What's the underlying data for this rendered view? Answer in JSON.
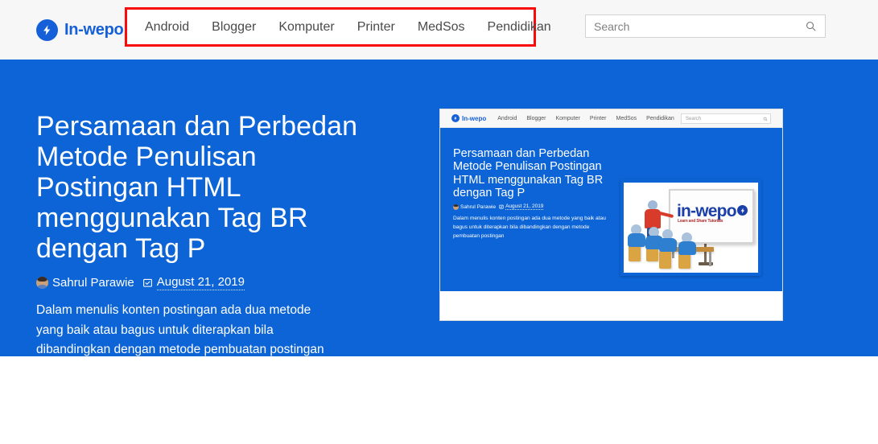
{
  "header": {
    "brand": {
      "name": "In-wepo",
      "icon": "bolt-icon",
      "color": "#1560d8"
    },
    "nav": [
      {
        "label": "Android"
      },
      {
        "label": "Blogger"
      },
      {
        "label": "Komputer"
      },
      {
        "label": "Printer"
      },
      {
        "label": "MedSos"
      },
      {
        "label": "Pendidikan"
      }
    ],
    "search": {
      "placeholder": "Search",
      "value": "",
      "icon": "search-icon"
    },
    "annotation": {
      "color": "#f90b0b",
      "target": "nav"
    }
  },
  "hero": {
    "background": "#0c64d6",
    "title": "Persamaan dan Perbedan Metode Penulisan Postingan HTML menggunakan Tag BR dengan Tag P",
    "author": "Sahrul Parawie",
    "date": "August 21, 2019",
    "author_icon": "avatar-icon",
    "date_icon": "calendar-icon",
    "description": "Dalam menulis konten postingan ada dua metode yang baik atau bagus untuk diterapkan bila dibandingkan dengan metode pembuatan postingan"
  },
  "thumbnail": {
    "brand": {
      "name": "In-wepo"
    },
    "nav": [
      {
        "label": "Android"
      },
      {
        "label": "Blogger"
      },
      {
        "label": "Komputer"
      },
      {
        "label": "Printer"
      },
      {
        "label": "MedSos"
      },
      {
        "label": "Pendidikan"
      }
    ],
    "search": {
      "placeholder": "Search"
    },
    "title": "Persamaan dan Perbedan Metode Penulisan Postingan HTML menggunakan Tag BR dengan Tag P",
    "author": "Sahrul Parawie",
    "date": "August 21, 2019",
    "description": "Dalam menulis konten postingan ada dua metode yang baik atau bagus untuk diterapkan bila dibandingkan dengan metode pembuatan postingan",
    "illustration": {
      "board_logo": "in-wepo",
      "board_tagline": "Learn and Share Tutorials"
    }
  }
}
